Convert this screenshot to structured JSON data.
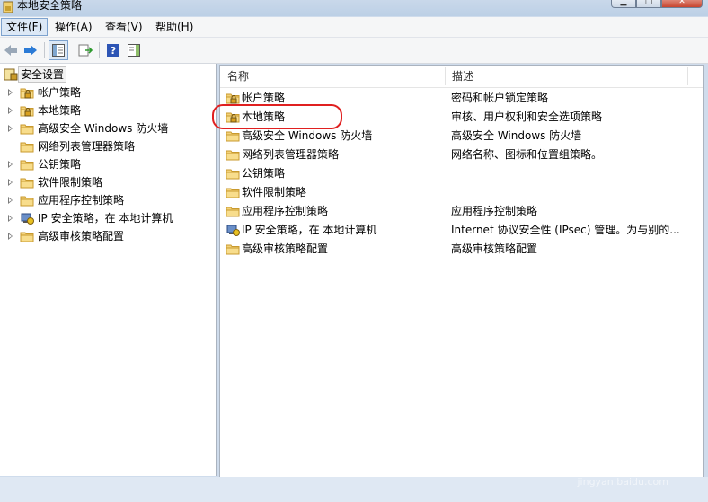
{
  "window": {
    "title": "本地安全策略"
  },
  "menu": [
    "文件(F)",
    "操作(A)",
    "查看(V)",
    "帮助(H)"
  ],
  "tree": {
    "root": "安全设置",
    "items": [
      {
        "label": "帐户策略",
        "icon": "folder-lock-icon",
        "expand": "arrow"
      },
      {
        "label": "本地策略",
        "icon": "folder-lock-icon",
        "expand": "arrow"
      },
      {
        "label": "高级安全 Windows 防火墙",
        "icon": "folder-icon",
        "expand": "arrow"
      },
      {
        "label": "网络列表管理器策略",
        "icon": "folder-icon",
        "expand": "none"
      },
      {
        "label": "公钥策略",
        "icon": "folder-icon",
        "expand": "arrow"
      },
      {
        "label": "软件限制策略",
        "icon": "folder-icon",
        "expand": "arrow"
      },
      {
        "label": "应用程序控制策略",
        "icon": "folder-icon",
        "expand": "arrow"
      },
      {
        "label": "IP 安全策略，在 本地计算机",
        "icon": "ip-security-icon",
        "expand": "arrow"
      },
      {
        "label": "高级审核策略配置",
        "icon": "folder-icon",
        "expand": "arrow"
      }
    ]
  },
  "list": {
    "columns": {
      "name": "名称",
      "description": "描述"
    },
    "rows": [
      {
        "name": "帐户策略",
        "description": "密码和帐户锁定策略",
        "icon": "folder-lock-icon"
      },
      {
        "name": "本地策略",
        "description": "审核、用户权利和安全选项策略",
        "icon": "folder-lock-icon"
      },
      {
        "name": "高级安全 Windows 防火墙",
        "description": "高级安全 Windows 防火墙",
        "icon": "folder-icon"
      },
      {
        "name": "网络列表管理器策略",
        "description": "网络名称、图标和位置组策略。",
        "icon": "folder-icon"
      },
      {
        "name": "公钥策略",
        "description": "",
        "icon": "folder-icon"
      },
      {
        "name": "软件限制策略",
        "description": "",
        "icon": "folder-icon"
      },
      {
        "name": "应用程序控制策略",
        "description": "应用程序控制策略",
        "icon": "folder-icon"
      },
      {
        "name": "IP 安全策略，在 本地计算机",
        "description": "Internet 协议安全性 (IPsec) 管理。为与别的...",
        "icon": "ip-security-icon"
      },
      {
        "name": "高级审核策略配置",
        "description": "高级审核策略配置",
        "icon": "folder-icon"
      }
    ]
  },
  "colors": {
    "accent": "#3c7fb1",
    "highlight_ring": "#e02020"
  },
  "watermark": {
    "brand": "Bai 经验",
    "url": "jingyan.baidu.com"
  }
}
